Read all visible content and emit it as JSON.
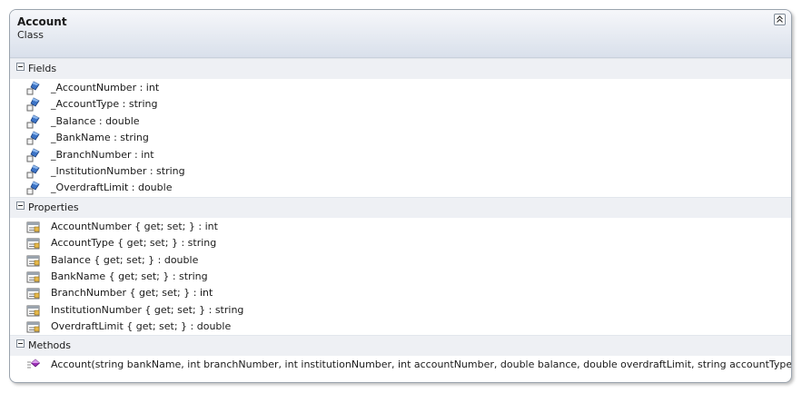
{
  "class_shape": {
    "name": "Account",
    "kind": "Class"
  },
  "icons": {
    "collapse": "double-chevron-up-icon",
    "compartment_toggle": "minus-box-icon",
    "field": "field-icon",
    "property": "property-icon",
    "method": "method-icon"
  },
  "colors": {
    "header_gradient_top": "#f6f7fa",
    "header_gradient_bottom": "#d9e0eb",
    "compartment_bg": "#eef0f4",
    "border": "#9aa3ad"
  },
  "compartments": {
    "fields": {
      "label": "Fields",
      "items": [
        "_AccountNumber : int",
        "_AccountType : string",
        "_Balance : double",
        "_BankName : string",
        "_BranchNumber : int",
        "_InstitutionNumber : string",
        "_OverdraftLimit : double"
      ]
    },
    "properties": {
      "label": "Properties",
      "items": [
        "AccountNumber { get; set; } : int",
        "AccountType { get; set; } : string",
        "Balance { get; set; } : double",
        "BankName { get; set; } : string",
        "BranchNumber { get; set; } : int",
        "InstitutionNumber { get; set; } : string",
        "OverdraftLimit { get; set; } : double"
      ]
    },
    "methods": {
      "label": "Methods",
      "items": [
        "Account(string bankName, int branchNumber, int institutionNumber, int accountNumber, double balance, double overdraftLimit, string accountType)"
      ]
    }
  }
}
